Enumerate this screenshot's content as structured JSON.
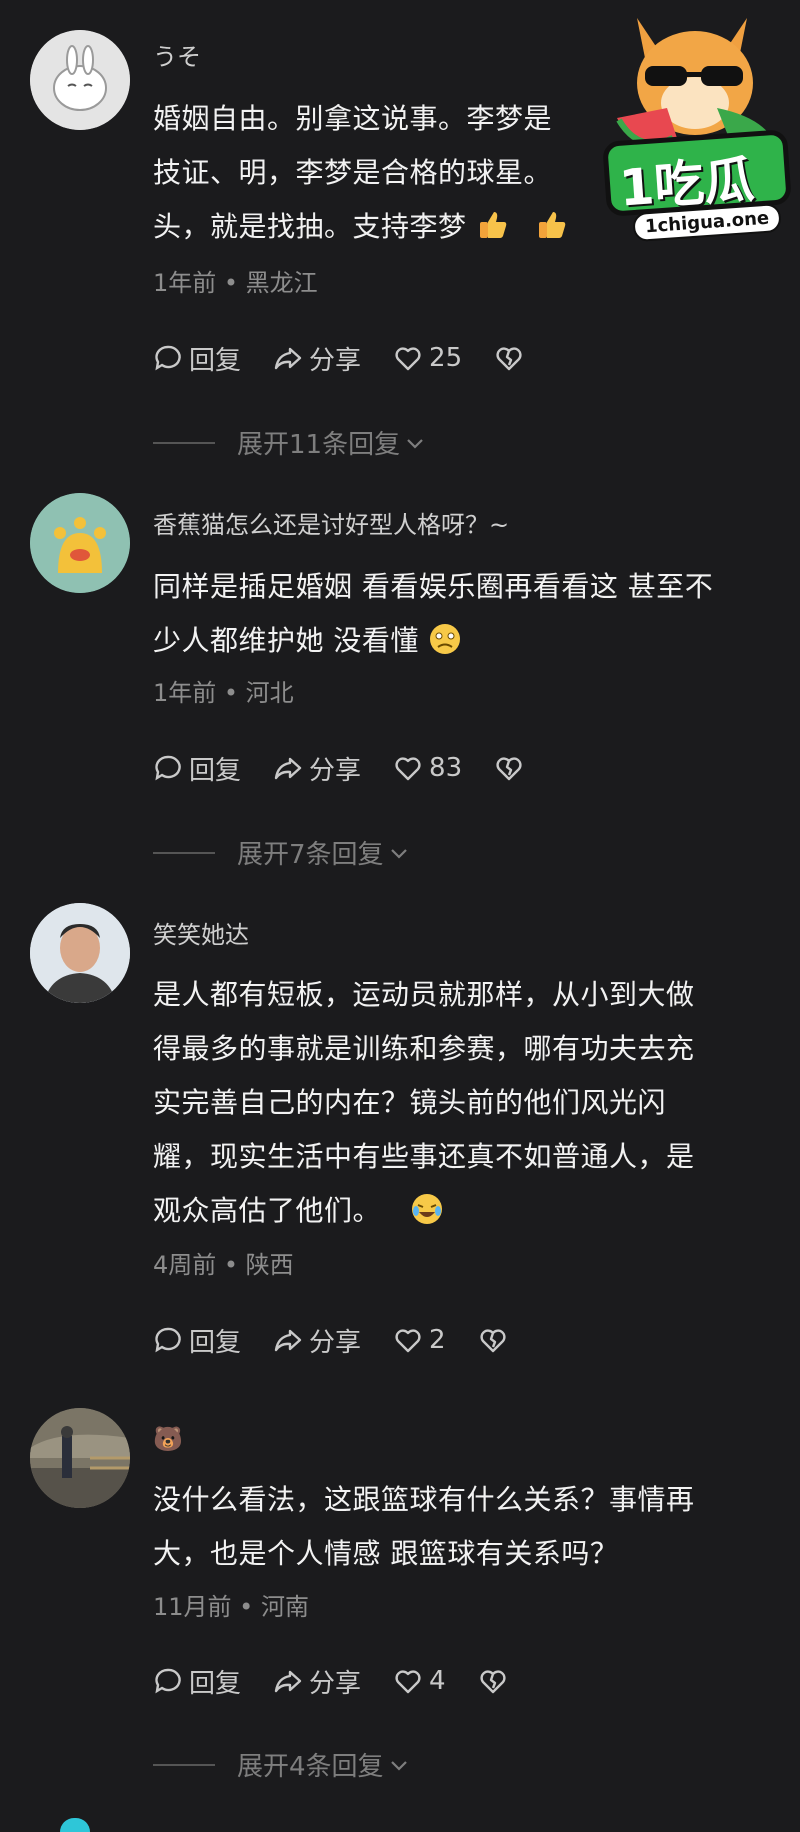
{
  "comments": [
    {
      "name": "うそ",
      "text": "婚姻自由。别拿这说事。李梦是…技证、明，李梦是合格的球星。…头，就是找抽。支持李梦",
      "lines": [
        "婚姻自由。别拿这说事。李梦是",
        "技证、明，李梦是合格的球星。",
        "头，就是找抽。支持李梦"
      ],
      "meta": "1年前 • 黑龙江",
      "reply": "回复",
      "share": "分享",
      "likes": "25",
      "expand": "展开11条回复"
    },
    {
      "name": "香蕉猫怎么还是讨好型人格呀？~",
      "lines": [
        "同样是插足婚姻 看看娱乐圈再看看这 甚至不",
        "少人都维护她 没看懂"
      ],
      "meta": "1年前 • 河北",
      "reply": "回复",
      "share": "分享",
      "likes": "83",
      "expand": "展开7条回复"
    },
    {
      "name": "笑笑她达",
      "lines": [
        "是人都有短板，运动员就那样，从小到大做",
        "得最多的事就是训练和参赛，哪有功夫去充",
        "实完善自己的内在？镜头前的他们风光闪",
        "耀，现实生活中有些事还真不如普通人，是",
        "观众高估了他们。"
      ],
      "meta": "4周前 • 陕西",
      "reply": "回复",
      "share": "分享",
      "likes": "2"
    },
    {
      "name": "🐻",
      "lines": [
        "没什么看法，这跟篮球有什么关系？事情再",
        "大，也是个人情感 跟篮球有关系吗？"
      ],
      "meta": "11月前 • 河南",
      "reply": "回复",
      "share": "分享",
      "likes": "4",
      "expand": "展开4条回复"
    }
  ],
  "watermark": {
    "brand": "1吃瓜",
    "site": "1chigua.one"
  },
  "icons": [
    "comment-icon",
    "share-icon",
    "heart-icon",
    "broken-heart-icon",
    "chevron-down-icon"
  ],
  "colors": {
    "background": "#1b1b1d",
    "text": "#f2f2f2",
    "meta": "#8d8d8d",
    "brand_green": "#2fb34a"
  }
}
